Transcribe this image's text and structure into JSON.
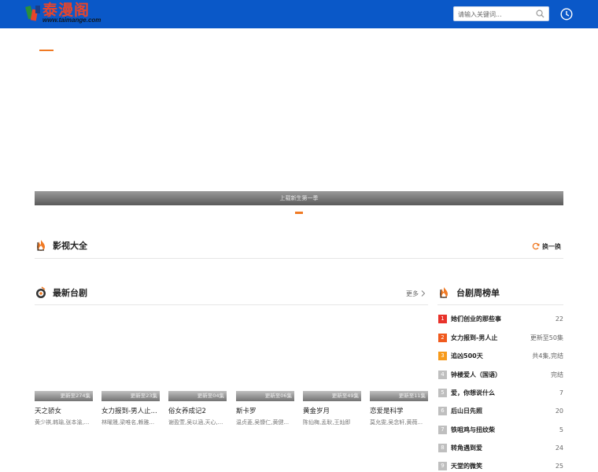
{
  "header": {
    "logo_text": "泰漫阁",
    "logo_url": "www.taimange.com",
    "search_placeholder": "请输入关键词...",
    "brand_color": "#0a58c8",
    "accent_color": "#f07a24"
  },
  "banner": {
    "caption": "上载新生第一季"
  },
  "sections": {
    "all_video": {
      "title": "影视大全",
      "refresh_label": "换一换"
    },
    "latest": {
      "title": "最新台剧",
      "more_label": "更多"
    },
    "weekly": {
      "title": "台剧周榜单"
    }
  },
  "latest_cards": [
    {
      "episode": "更新至274集",
      "title": "天之骄女",
      "actors": "黄少祺,韩瑜,张本渝,..."
    },
    {
      "episode": "更新至23集",
      "title": "女力报到-男人止...",
      "actors": "林曜晟,梁唯名,赖雅..."
    },
    {
      "episode": "更新至04集",
      "title": "俗女养成记2",
      "actors": "谢盈萱,吴以涵,天心,..."
    },
    {
      "episode": "更新至06集",
      "title": "斯卡罗",
      "actors": "温贞菱,吴慷仁,黄健..."
    },
    {
      "episode": "更新至49集",
      "title": "黄金岁月",
      "actors": "陈仙梅,孟耿,王灿即"
    },
    {
      "episode": "更新至11集",
      "title": "恋爱是科学",
      "actors": "莫允雯,吴念轩,黄薇..."
    }
  ],
  "ranking": [
    {
      "rank": "1",
      "title": "她们创业的那些事",
      "status": "22",
      "color": "#e8322a"
    },
    {
      "rank": "2",
      "title": "女力报到-男人止",
      "status": "更新至50集",
      "color": "#f05a1e"
    },
    {
      "rank": "3",
      "title": "追凶500天",
      "status": "共4集,完结",
      "color": "#f79a1a"
    },
    {
      "rank": "4",
      "title": "钟楼爱人（国语）",
      "status": "完结",
      "color": "#bfbfbf"
    },
    {
      "rank": "5",
      "title": "爱，你想说什么",
      "status": "7",
      "color": "#bfbfbf"
    },
    {
      "rank": "6",
      "title": "后山日先照",
      "status": "20",
      "color": "#bfbfbf"
    },
    {
      "rank": "7",
      "title": "铁咀鸡与扭纹柴",
      "status": "5",
      "color": "#bfbfbf"
    },
    {
      "rank": "8",
      "title": "转角遇到爱",
      "status": "24",
      "color": "#bfbfbf"
    },
    {
      "rank": "9",
      "title": "天堂的微笑",
      "status": "25",
      "color": "#bfbfbf"
    }
  ]
}
